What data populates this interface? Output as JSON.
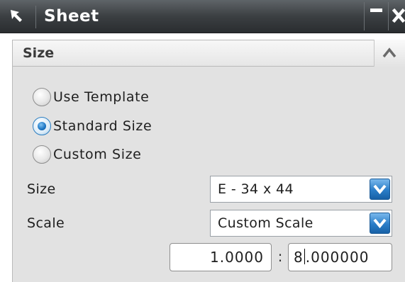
{
  "window": {
    "title": "Sheet",
    "icons": {
      "title": "select-arrow-icon",
      "minimize": "minimize-icon",
      "close": "close-icon"
    }
  },
  "section": {
    "title": "Size",
    "collapse_icon": "chevron-up-icon"
  },
  "radios": {
    "use_template": {
      "label": "Use Template",
      "checked": false
    },
    "standard_size": {
      "label": "Standard Size",
      "checked": true
    },
    "custom_size": {
      "label": "Custom Size",
      "checked": false
    }
  },
  "size_field": {
    "label": "Size",
    "value": "E - 34 x 44",
    "arrow_icon": "dropdown-arrow-icon"
  },
  "scale_field": {
    "label": "Scale",
    "value": "Custom Scale",
    "arrow_icon": "dropdown-arrow-icon"
  },
  "scale_ratio": {
    "numerator": "1.0000",
    "separator": ":",
    "denominator_before_caret": "8",
    "denominator_after_caret": ".000000"
  },
  "colors": {
    "titlebar": "#3b3f42",
    "panel_background": "#e2e2e2",
    "accent_blue": "#2a7dc8"
  }
}
